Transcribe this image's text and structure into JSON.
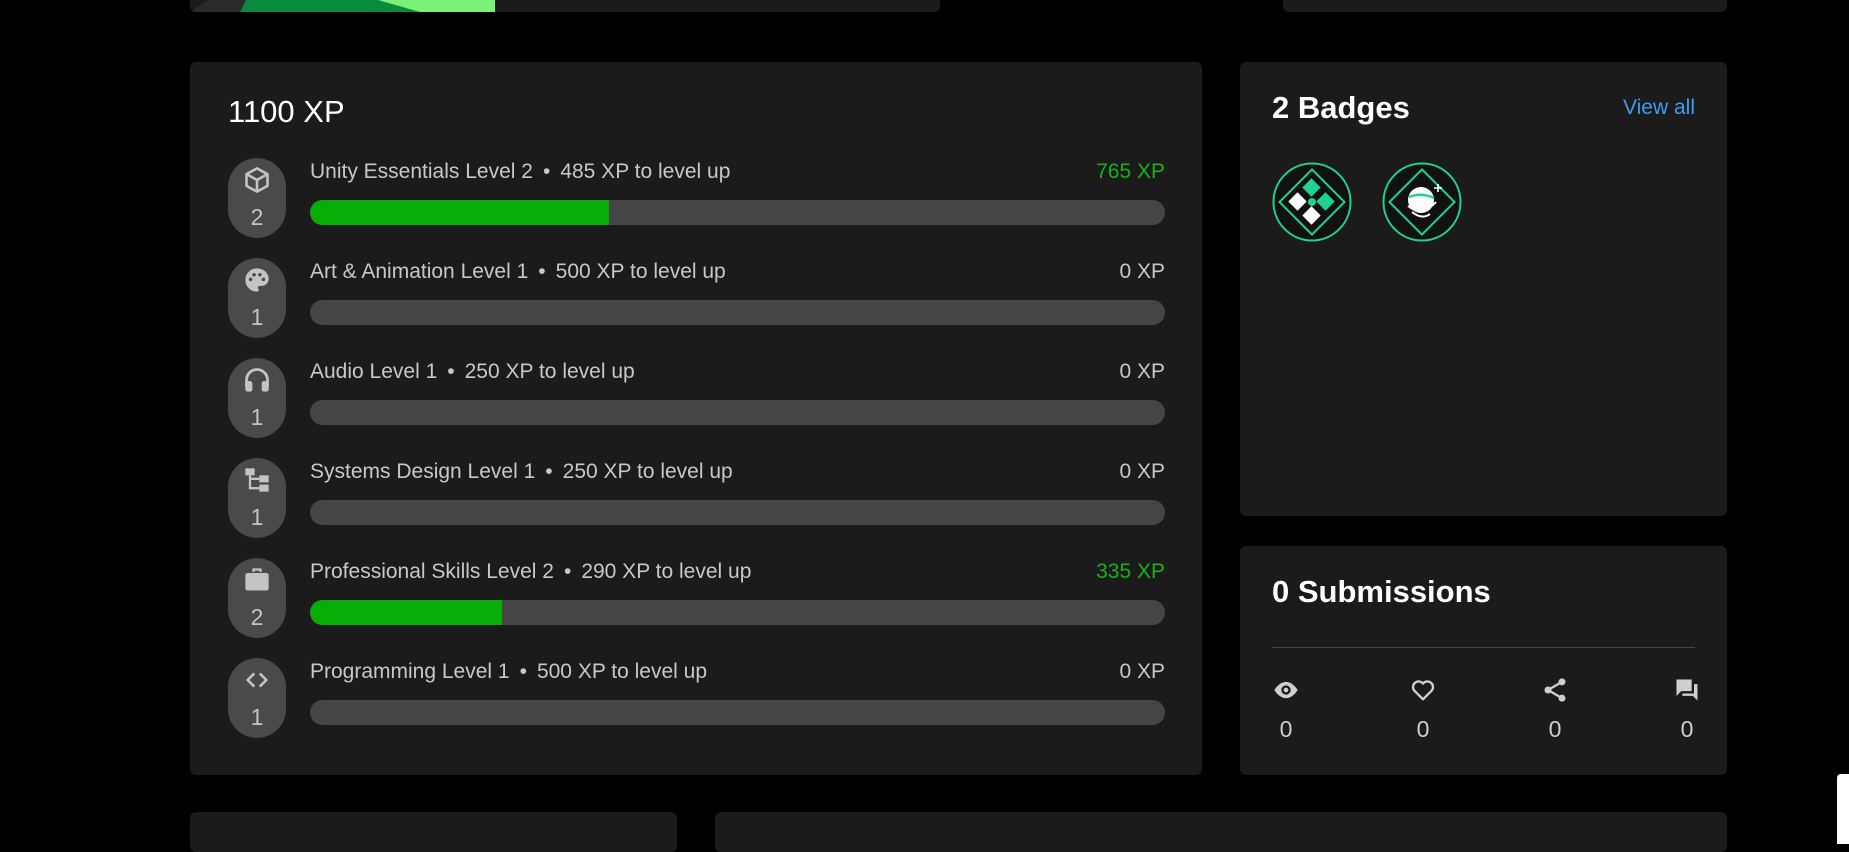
{
  "colors": {
    "background": "#000000",
    "panel": "#1b1b1b",
    "progress_fill": "#06ad06",
    "progress_track": "#454545",
    "xp_active": "#17b117",
    "link": "#3f9cf3",
    "badge_ring": "#1fd28f"
  },
  "xp_panel": {
    "title": "1100 XP",
    "skills": [
      {
        "icon": "unity-cube-icon",
        "level_badge": "2",
        "name": "Unity Essentials Level 2",
        "to_level": "485 XP to level up",
        "xp": "765 XP",
        "progress": 0.35
      },
      {
        "icon": "palette-icon",
        "level_badge": "1",
        "name": "Art & Animation Level 1",
        "to_level": "500 XP to level up",
        "xp": "0 XP",
        "progress": 0
      },
      {
        "icon": "headphones-icon",
        "level_badge": "1",
        "name": "Audio Level 1",
        "to_level": "250 XP to level up",
        "xp": "0 XP",
        "progress": 0
      },
      {
        "icon": "hierarchy-icon",
        "level_badge": "1",
        "name": "Systems Design Level 1",
        "to_level": "250 XP to level up",
        "xp": "0 XP",
        "progress": 0
      },
      {
        "icon": "briefcase-icon",
        "level_badge": "2",
        "name": "Professional Skills Level 2",
        "to_level": "290 XP to level up",
        "xp": "335 XP",
        "progress": 0.225
      },
      {
        "icon": "code-brackets-icon",
        "level_badge": "1",
        "name": "Programming Level 1",
        "to_level": "500 XP to level up",
        "xp": "0 XP",
        "progress": 0
      }
    ]
  },
  "badges_panel": {
    "title": "2 Badges",
    "view_all": "View all",
    "badges": [
      {
        "icon": "puzzle-diamond-badge-icon"
      },
      {
        "icon": "planet-badge-icon"
      }
    ]
  },
  "submissions_panel": {
    "title": "0 Submissions",
    "stats": [
      {
        "icon": "eye-icon",
        "value": "0"
      },
      {
        "icon": "heart-icon",
        "value": "0"
      },
      {
        "icon": "share-icon",
        "value": "0"
      },
      {
        "icon": "comment-icon",
        "value": "0"
      }
    ]
  }
}
